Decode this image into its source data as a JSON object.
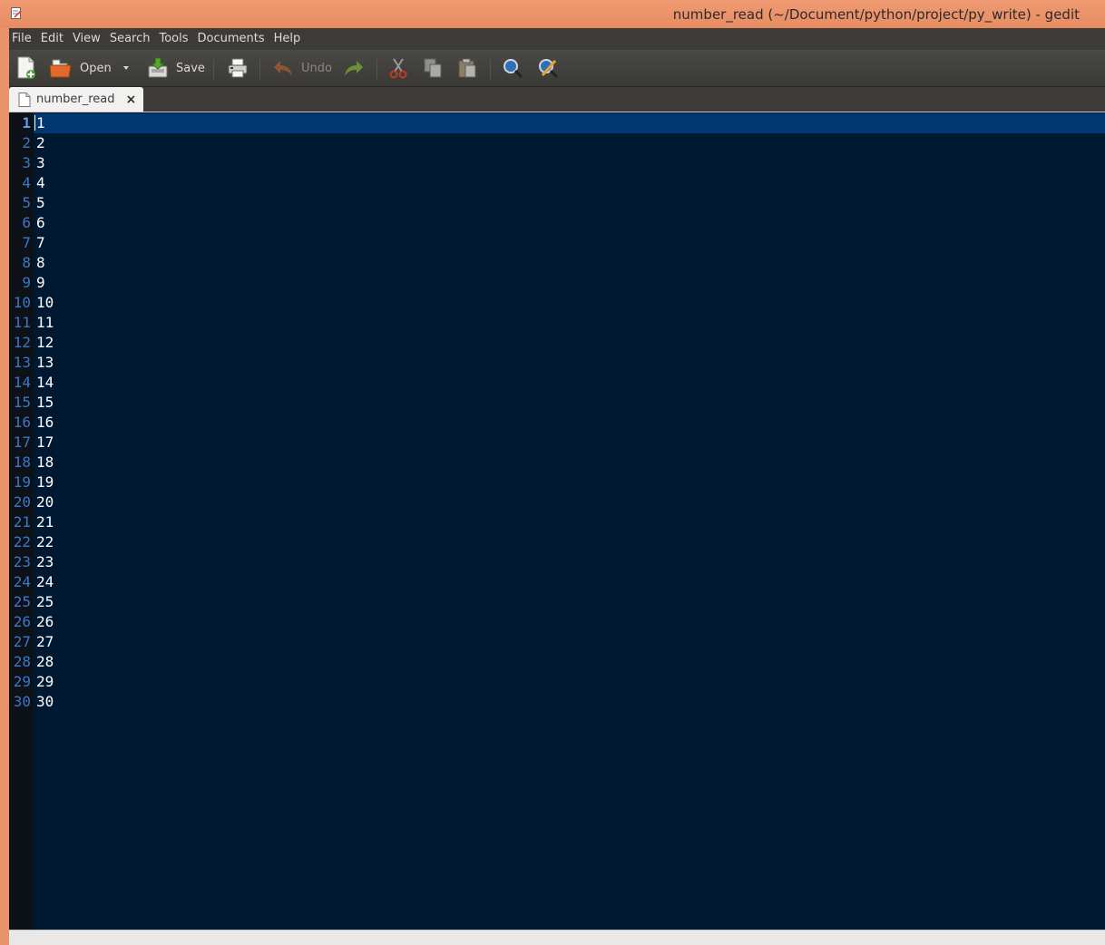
{
  "window": {
    "title": "number_read (~/Document/python/project/py_write) - gedit"
  },
  "menu": [
    "File",
    "Edit",
    "View",
    "Search",
    "Tools",
    "Documents",
    "Help"
  ],
  "toolbar": {
    "open_label": "Open",
    "save_label": "Save",
    "undo_label": "Undo",
    "icons": [
      "new-document-icon",
      "open-folder-icon",
      "dropdown-arrow-icon",
      "save-icon",
      "print-icon",
      "undo-icon",
      "redo-icon",
      "cut-icon",
      "copy-icon",
      "paste-icon",
      "search-icon",
      "replace-icon"
    ]
  },
  "tabs": [
    {
      "label": "number_read",
      "close": "×"
    }
  ],
  "editor": {
    "current_line": 1,
    "lines": [
      "1",
      "2",
      "3",
      "4",
      "5",
      "6",
      "7",
      "8",
      "9",
      "10",
      "11",
      "12",
      "13",
      "14",
      "15",
      "16",
      "17",
      "18",
      "19",
      "20",
      "21",
      "22",
      "23",
      "24",
      "25",
      "26",
      "27",
      "28",
      "29",
      "30"
    ]
  },
  "colors": {
    "titlebar": "#e9936a",
    "editor_bg": "#001933",
    "current_line_bg": "#003770",
    "line_number": "#3a77c9",
    "text": "#ffffff"
  }
}
